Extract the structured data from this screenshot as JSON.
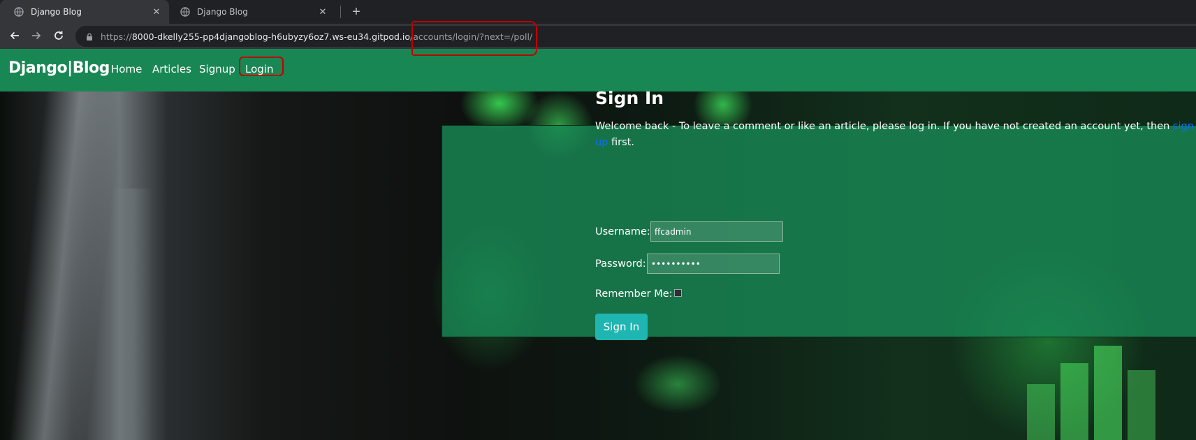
{
  "browser": {
    "tabs": [
      {
        "title": "Django Blog",
        "active": true
      },
      {
        "title": "Django Blog",
        "active": false
      }
    ],
    "url_prefix": "https://",
    "url_host": "8000-dkelly255-pp4djangoblog-h6ubyzy6oz7.ws-eu34.gitpod.io",
    "url_path": "/accounts/login/?next=/poll/"
  },
  "navbar": {
    "brand": "Django|Blog",
    "links": [
      "Home",
      "Articles",
      "Signup",
      "Login"
    ]
  },
  "signin": {
    "title": "Sign In",
    "welcome_text": "Welcome back - To leave a comment or like an article, please log in. If you have not created an account yet, then ",
    "signup_link": "sign up",
    "welcome_end": " first.",
    "username_label": "Username:",
    "username_value": "ffcadmin",
    "password_label": "Password:",
    "password_value": "••••••••••",
    "remember_label": "Remember Me:",
    "remember_checked": false,
    "button_label": "Sign In"
  },
  "colors": {
    "navbar": "#198754",
    "button": "#1fb5b0",
    "annotation": "#c00000"
  }
}
